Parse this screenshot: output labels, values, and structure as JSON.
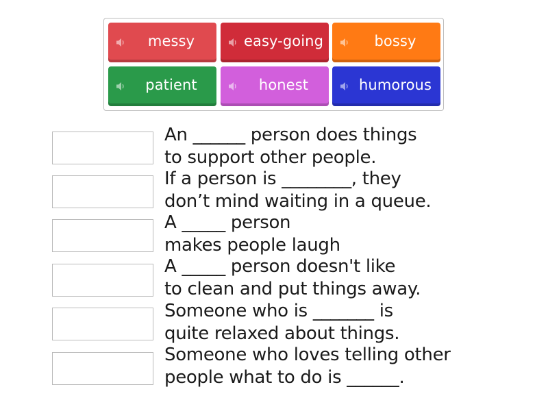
{
  "word_bank": {
    "tiles": [
      {
        "label": "messy",
        "color": "#e04a4f",
        "icon": "speaker-icon"
      },
      {
        "label": "easy-going",
        "color": "#d02c39",
        "icon": "speaker-icon"
      },
      {
        "label": "bossy",
        "color": "#ff7a14",
        "icon": "speaker-icon"
      },
      {
        "label": "patient",
        "color": "#2a9a4a",
        "icon": "speaker-icon"
      },
      {
        "label": "honest",
        "color": "#d25fdc",
        "icon": "speaker-icon"
      },
      {
        "label": "humorous",
        "color": "#2b36d3",
        "icon": "speaker-icon"
      }
    ]
  },
  "questions": [
    {
      "line1": "An ______ person does things",
      "line2": "to support other people."
    },
    {
      "line1": "If a person is ________, they",
      "line2": "don’t mind waiting in a queue."
    },
    {
      "line1": "A _____ person",
      "line2": "makes people laugh"
    },
    {
      "line1": "A _____ person doesn't like",
      "line2": "to clean and put things away."
    },
    {
      "line1": "Someone who is _______ is",
      "line2": "quite relaxed about things."
    },
    {
      "line1": "Someone who loves telling other",
      "line2": "people what to do is ______."
    }
  ]
}
